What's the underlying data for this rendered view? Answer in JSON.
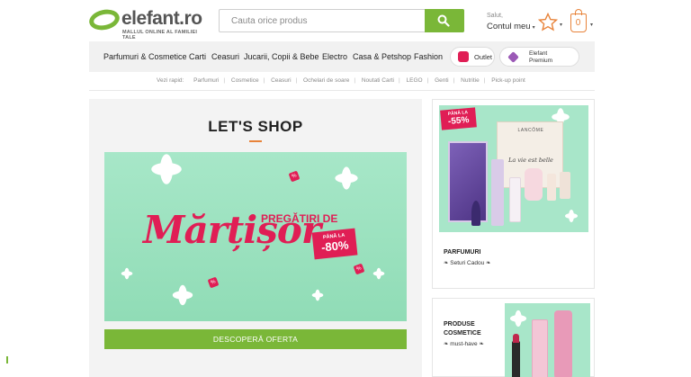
{
  "brand": {
    "name": "elefant.ro",
    "tagline": "MALLUL ONLINE AL FAMILIEI TALE",
    "accent": "#7ab738",
    "orange": "#e8833a",
    "pink": "#e01e55"
  },
  "search": {
    "placeholder": "Cauta orice produs",
    "icon": "search-icon"
  },
  "account": {
    "greeting": "Salut,",
    "label": "Contul meu",
    "caret": "▾"
  },
  "cart": {
    "count": "0",
    "caret": "▾"
  },
  "wishlist": {
    "caret": "▾"
  },
  "nav": {
    "items": [
      "Parfumuri & Cosmetice",
      "Carti",
      "Ceasuri",
      "Jucarii, Copii & Bebe",
      "Electro",
      "Casa & Petshop",
      "Fashion"
    ],
    "outlet": "Outlet",
    "premium_line1": "Elefant",
    "premium_line2": "Premium"
  },
  "quick_links": {
    "label": "Vezi rapid:",
    "items": [
      "Parfumuri",
      "Cosmetice",
      "Ceasuri",
      "Ochelari de soare",
      "Noutati Carti",
      "LEGO",
      "Genti",
      "Nutritie",
      "Pick-up point"
    ]
  },
  "promo": {
    "title": "LET'S SHOP",
    "banner_headline": "Mărțișor",
    "banner_sub": "PREGĂTIRI DE",
    "banner_badge_top": "PÂNĂ LA",
    "banner_badge_value": "-80%",
    "cta": "DESCOPERĂ OFERTA"
  },
  "cards": [
    {
      "title": "PARFUMURI",
      "subtitle": "❧ Seturi Cadou ❧",
      "badge_top": "PÂNĂ LA",
      "badge_value": "-55%",
      "box_brand": "LANCÔME",
      "box_text": "La vie est belle"
    },
    {
      "title_line1": "PRODUSE",
      "title_line2": "COSMETICE",
      "subtitle": "❧ must-have ❧"
    }
  ]
}
